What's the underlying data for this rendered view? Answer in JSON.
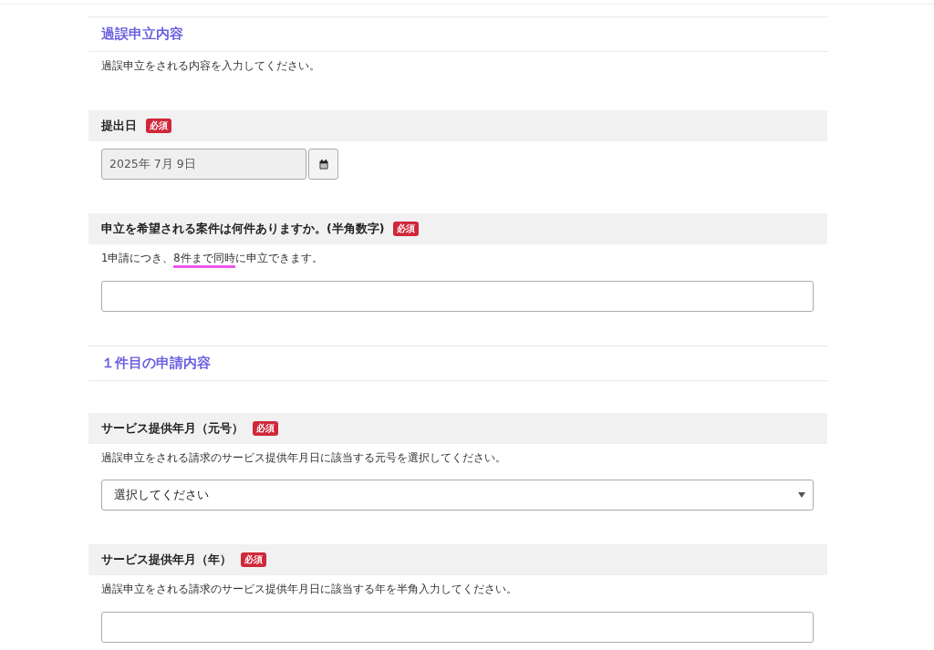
{
  "sections": [
    {
      "title": "過誤申立内容",
      "description": "過誤申立をされる内容を入力してください。",
      "fields": [
        {
          "kind": "date",
          "label": "提出日",
          "required": true,
          "required_label": "必須",
          "value": "2025年 7月 9日",
          "disabled": true
        },
        {
          "kind": "text",
          "label": "申立を希望される案件は何件ありますか。(半角数字)",
          "required": true,
          "required_label": "必須",
          "hint": [
            {
              "text": "1申請につき、",
              "underlined": false
            },
            {
              "text": "8件まで同時",
              "underlined": true
            },
            {
              "text": "に申立できます。",
              "underlined": false
            }
          ]
        }
      ]
    },
    {
      "title": "１件目の申請内容",
      "fields": [
        {
          "kind": "select",
          "label": "サービス提供年月（元号）",
          "required": true,
          "required_label": "必須",
          "hint": [
            {
              "text": "過誤申立をされる請求のサービス提供年月日に該当する元号を選択してください。",
              "underlined": false
            }
          ],
          "value": "選択してください"
        },
        {
          "kind": "text",
          "label": "サービス提供年月（年）",
          "required": true,
          "required_label": "必須",
          "hint": [
            {
              "text": "過誤申立をされる請求のサービス提供年月日に該当する年を半角入力してください。",
              "underlined": false
            }
          ]
        }
      ]
    }
  ]
}
